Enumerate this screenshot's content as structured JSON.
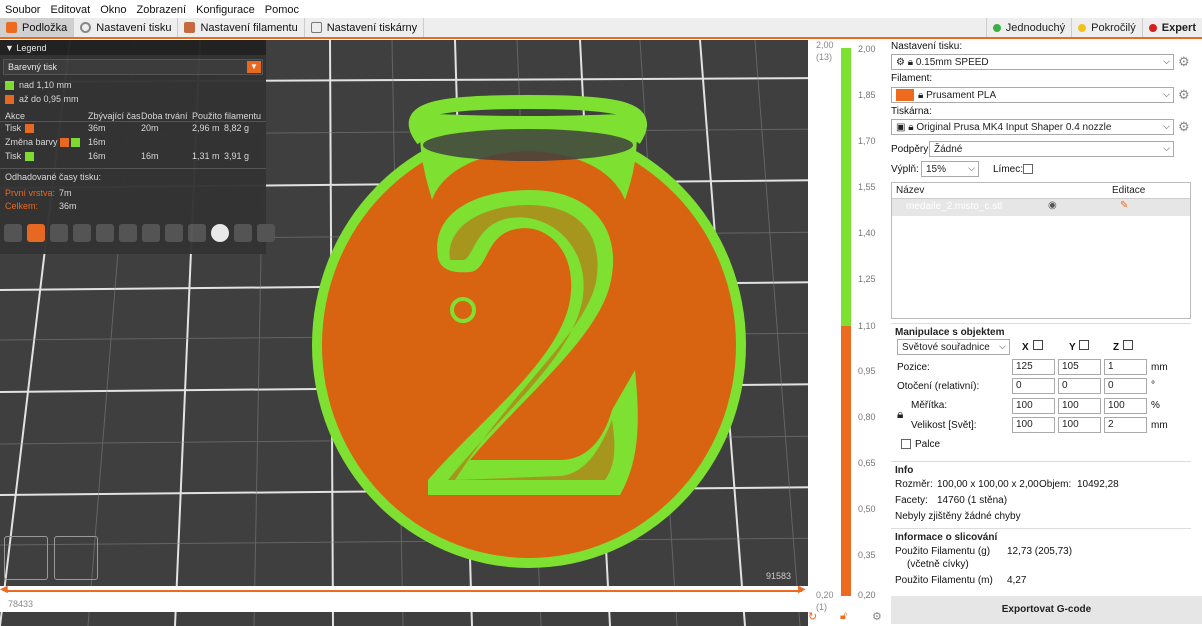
{
  "menu": [
    "Soubor",
    "Editovat",
    "Okno",
    "Zobrazení",
    "Konfigurace",
    "Pomoc"
  ],
  "tabs": [
    {
      "label": "Podložka",
      "color": "#ed6b21"
    },
    {
      "label": "Nastavení tisku",
      "color": "#888888"
    },
    {
      "label": "Nastavení filamentu",
      "color": "#c46a3c"
    },
    {
      "label": "Nastavení tiskárny",
      "color": "#777777"
    }
  ],
  "modes": [
    {
      "label": "Jednoduchý",
      "color": "#3cb043"
    },
    {
      "label": "Pokročilý",
      "color": "#f2c21b"
    },
    {
      "label": "Expert",
      "color": "#d62020"
    }
  ],
  "legend": {
    "title": "Legend",
    "view_type": "Barevný tisk",
    "ranges": [
      {
        "label": "nad 1,10 mm",
        "color": "#7ee030"
      },
      {
        "label": "až do 0,95 mm",
        "color": "#ed6b21"
      }
    ],
    "headers": [
      "Akce",
      "Zbývající čas",
      "Doba trvání",
      "Použito filamentu"
    ],
    "rows": [
      {
        "action": "Tisk",
        "remaining": "36m",
        "duration": "20m",
        "used_m": "2,96 m",
        "used_g": "8,82 g",
        "colors": [
          "#ed6b21"
        ]
      },
      {
        "action": "Změna barvy",
        "remaining": "16m",
        "duration": "",
        "used_m": "",
        "used_g": "",
        "colors": [
          "#ed6b21",
          "#7ee030"
        ]
      },
      {
        "action": "Tisk",
        "remaining": "16m",
        "duration": "16m",
        "used_m": "1,31 m",
        "used_g": "3,91 g",
        "colors": [
          "#7ee030"
        ]
      }
    ],
    "estimate_title": "Odhadované časy tisku:",
    "first_layer_label": "První vrstva:",
    "first_layer_value": "7m",
    "total_label": "Celkem:",
    "total_value": "36m"
  },
  "hslider": {
    "left": "78433",
    "right": "91583"
  },
  "vslider": {
    "top_value": "2,00",
    "top_layer": "(13)",
    "bottom_value": "0,20",
    "bottom_layer": "(1)",
    "ticks": [
      "2,00",
      "1,85",
      "1,70",
      "1,55",
      "1,40",
      "1,25",
      "1,10",
      "0,95",
      "0,80",
      "0,65",
      "0,50",
      "0,35",
      "0,20"
    ]
  },
  "right": {
    "print_settings_label": "Nastavení tisku:",
    "print_settings_value": "0.15mm SPEED",
    "filament_label": "Filament:",
    "filament_value": "Prusament PLA",
    "filament_color": "#ed6b21",
    "printer_label": "Tiskárna:",
    "printer_value": "Original Prusa MK4 Input Shaper 0.4 nozzle",
    "supports_label": "Podpěry:",
    "supports_value": "Žádné",
    "infill_label": "Výplň:",
    "infill_value": "15%",
    "brim_label": "Límec:",
    "list_name_header": "Název",
    "list_edit_header": "Editace",
    "object_name": "medaile_2.misto_c.stl",
    "manip_title": "Manipulace s objektem",
    "coords_value": "Světové souřadnice",
    "axes": [
      "X",
      "Y",
      "Z"
    ],
    "position_label": "Pozice:",
    "position": [
      "125",
      "105",
      "1"
    ],
    "unit_mm": "mm",
    "rotation_label": "Otočení (relativní):",
    "rotation": [
      "0",
      "0",
      "0"
    ],
    "unit_deg": "°",
    "scale_label": "Měřítka:",
    "scale": [
      "100",
      "100",
      "100"
    ],
    "unit_pct": "%",
    "size_label": "Velikost [Svět]:",
    "size": [
      "100",
      "100",
      "2"
    ],
    "inches_label": "Palce",
    "info_title": "Info",
    "size_info_label": "Rozměr:",
    "size_info_value": "100,00 x 100,00 x 2,00",
    "volume_label": "Objem:",
    "volume_value": "10492,28",
    "facets_label": "Facety:",
    "facets_value": "14760 (1 stěna)",
    "errors_text": "Nebyly zjištěny žádné chyby",
    "slice_title": "Informace o slicování",
    "filament_g_label": "Použito Filamentu (g)",
    "filament_g_sub": "(včetně cívky)",
    "filament_g_value": "12,73 (205,73)",
    "filament_m_label": "Použito Filamentu (m)",
    "filament_m_value": "4,27",
    "export_label": "Exportovat G-code"
  }
}
